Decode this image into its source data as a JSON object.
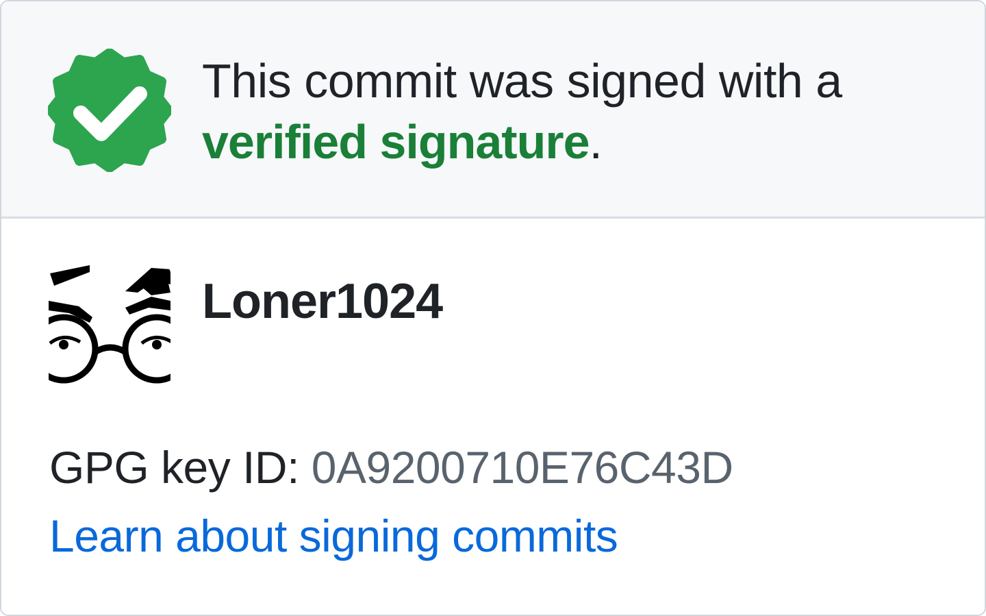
{
  "header": {
    "badge_icon": "verified-badge-icon",
    "message_prefix": "This commit was signed with a",
    "verified_link_label": "verified signature",
    "message_suffix": ".",
    "accent_color": "#1a7f37"
  },
  "signer": {
    "avatar_icon": "user-avatar",
    "username": "Loner1024"
  },
  "gpg": {
    "label": "GPG key ID:",
    "key_id": "0A9200710E76C43D"
  },
  "footer": {
    "learn_link_label": "Learn about signing commits",
    "link_color": "#0969da"
  }
}
